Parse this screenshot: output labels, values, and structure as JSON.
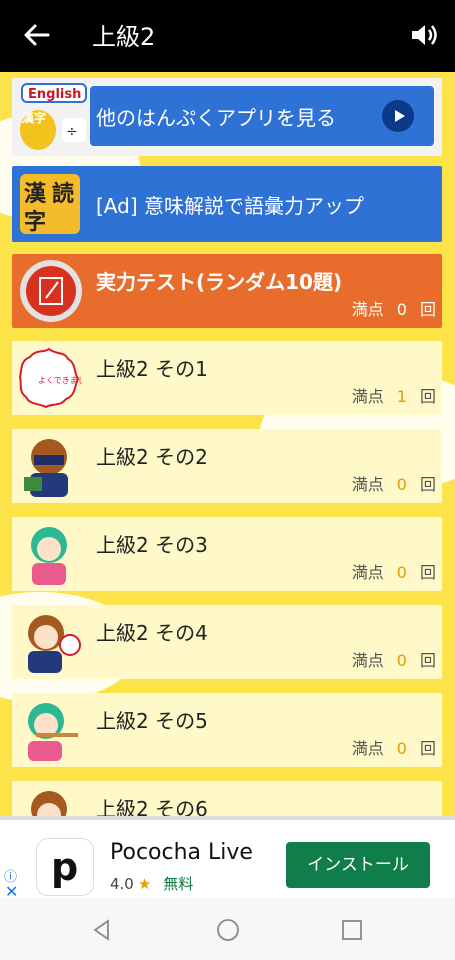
{
  "topbar": {
    "title": "上級2"
  },
  "banners": {
    "other_apps": {
      "label": "他のはんぷくアプリを見る",
      "tag": "English",
      "tag2": "漢字"
    },
    "ad_banner": {
      "label": "[Ad] 意味解説で語彙力アップ",
      "icon_chars": [
        "漢",
        "字",
        "読"
      ]
    }
  },
  "test": {
    "title": "実力テスト(ランダム10題)",
    "score_label": "満点",
    "score_value": "0",
    "score_unit": "回"
  },
  "rows": [
    {
      "name": "上級2 その1",
      "score_label": "満点",
      "score_value": "1",
      "score_unit": "回"
    },
    {
      "name": "上級2 その2",
      "score_label": "満点",
      "score_value": "0",
      "score_unit": "回"
    },
    {
      "name": "上級2 その3",
      "score_label": "満点",
      "score_value": "0",
      "score_unit": "回"
    },
    {
      "name": "上級2 その4",
      "score_label": "満点",
      "score_value": "0",
      "score_unit": "回"
    },
    {
      "name": "上級2 その5",
      "score_label": "満点",
      "score_value": "0",
      "score_unit": "回"
    },
    {
      "name": "上級2 その6",
      "score_label": "",
      "score_value": "",
      "score_unit": ""
    }
  ],
  "ad": {
    "app_name": "Pococha Live",
    "rating": "4.0",
    "price": "無料",
    "install_label": "インストール",
    "icon_letter": "p"
  },
  "colors": {
    "accent_blue": "#2f72d6",
    "test_orange": "#e86d2d",
    "row_bg": "#fff8c9",
    "background": "#fde34a"
  }
}
